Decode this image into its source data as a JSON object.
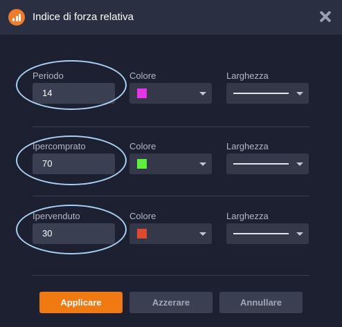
{
  "dialog": {
    "title": "Indice di forza relativa"
  },
  "rows": [
    {
      "param_label": "Periodo",
      "param_value": "14",
      "color_label": "Colore",
      "color": "#e535e5",
      "width_label": "Larghezza"
    },
    {
      "param_label": "Ipercomprato",
      "param_value": "70",
      "color_label": "Colore",
      "color": "#5ef03b",
      "width_label": "Larghezza"
    },
    {
      "param_label": "Ipervenduto",
      "param_value": "30",
      "color_label": "Colore",
      "color": "#e0492d",
      "width_label": "Larghezza"
    }
  ],
  "buttons": {
    "apply": "Applicare",
    "reset": "Azzerare",
    "cancel": "Annullare"
  },
  "colors": {
    "accent": "#f07a11",
    "highlight_oval": "#a9d0f5"
  }
}
